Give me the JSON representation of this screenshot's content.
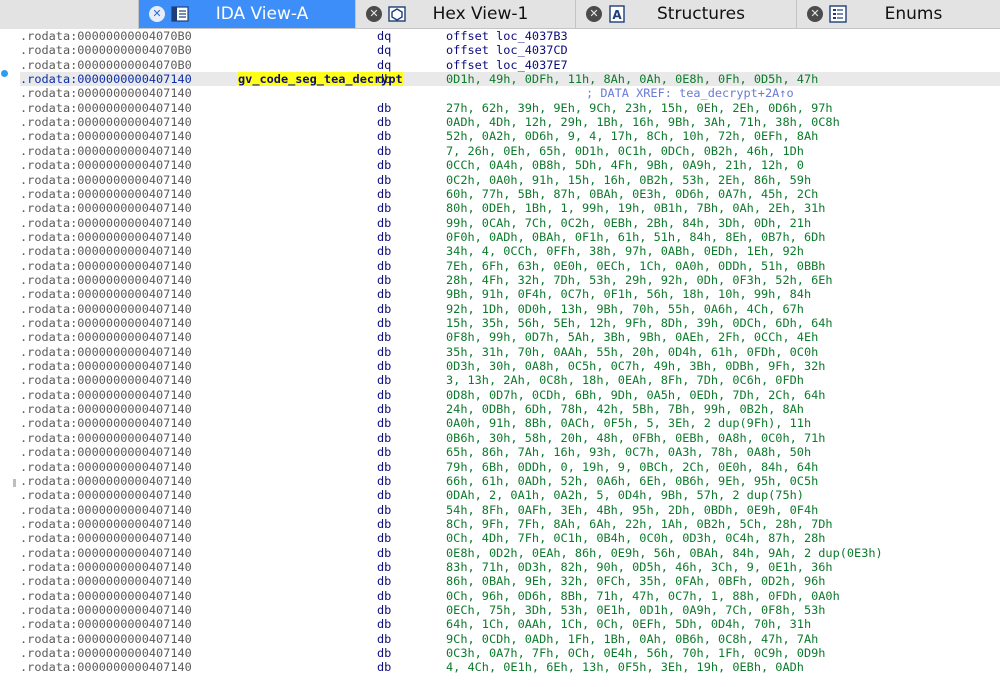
{
  "tabs": [
    {
      "label": "IDA View-A",
      "active": true,
      "icon": "ida-view-icon"
    },
    {
      "label": "Hex View-1",
      "active": false,
      "icon": "hex-view-icon"
    },
    {
      "label": "Structures",
      "active": false,
      "icon": "structures-icon"
    },
    {
      "label": "Enums",
      "active": false,
      "icon": "enums-icon"
    }
  ],
  "colors": {
    "accent": "#3d8ef8",
    "address": "#5b5b5b",
    "name_highlight": "#ffff1a",
    "operand": "#0c7a2c",
    "mnemonic": "#0b0b7c",
    "comment": "#6a7ad6"
  },
  "listing": [
    {
      "addr": ".rodata:00000000004070B0",
      "mnem": "dq",
      "ops": "offset loc_4037B3",
      "kind": "dq"
    },
    {
      "addr": ".rodata:00000000004070B0",
      "mnem": "dq",
      "ops": "offset loc_4037CD",
      "kind": "dq"
    },
    {
      "addr": ".rodata:00000000004070B0",
      "mnem": "dq",
      "ops": "offset loc_4037E7",
      "kind": "dq"
    },
    {
      "addr": ".rodata:0000000000407140",
      "name": "gv_code_seg_tea_decrypt",
      "mnem": "db",
      "ops": "0D1h, 49h, 0DFh, 11h, 8Ah, 0Ah, 0E8h, 0Fh, 0D5h, 47h",
      "kind": "db",
      "current": true
    },
    {
      "addr": ".rodata:0000000000407140",
      "comment": "; DATA XREF: tea_decrypt+2A↑o"
    },
    {
      "addr": ".rodata:0000000000407140",
      "mnem": "db",
      "ops": "27h, 62h, 39h, 9Eh, 9Ch, 23h, 15h, 0Eh, 2Eh, 0D6h, 97h"
    },
    {
      "addr": ".rodata:0000000000407140",
      "mnem": "db",
      "ops": "0ADh, 4Dh, 12h, 29h, 1Bh, 16h, 9Bh, 3Ah, 71h, 38h, 0C8h"
    },
    {
      "addr": ".rodata:0000000000407140",
      "mnem": "db",
      "ops": "52h, 0A2h, 0D6h, 9, 4, 17h, 8Ch, 10h, 72h, 0EFh, 8Ah"
    },
    {
      "addr": ".rodata:0000000000407140",
      "mnem": "db",
      "ops": "7, 26h, 0Eh, 65h, 0D1h, 0C1h, 0DCh, 0B2h, 46h, 1Dh"
    },
    {
      "addr": ".rodata:0000000000407140",
      "mnem": "db",
      "ops": "0CCh, 0A4h, 0B8h, 5Dh, 4Fh, 9Bh, 0A9h, 21h, 12h, 0"
    },
    {
      "addr": ".rodata:0000000000407140",
      "mnem": "db",
      "ops": "0C2h, 0A0h, 91h, 15h, 16h, 0B2h, 53h, 2Eh, 86h, 59h"
    },
    {
      "addr": ".rodata:0000000000407140",
      "mnem": "db",
      "ops": "60h, 77h, 5Bh, 87h, 0BAh, 0E3h, 0D6h, 0A7h, 45h, 2Ch"
    },
    {
      "addr": ".rodata:0000000000407140",
      "mnem": "db",
      "ops": "80h, 0DEh, 1Bh, 1, 99h, 19h, 0B1h, 7Bh, 0Ah, 2Eh, 31h"
    },
    {
      "addr": ".rodata:0000000000407140",
      "mnem": "db",
      "ops": "99h, 0CAh, 7Ch, 0C2h, 0EBh, 2Bh, 84h, 3Dh, 0Dh, 21h"
    },
    {
      "addr": ".rodata:0000000000407140",
      "mnem": "db",
      "ops": "0F0h, 0ADh, 0BAh, 0F1h, 61h, 51h, 84h, 8Eh, 0B7h, 6Dh"
    },
    {
      "addr": ".rodata:0000000000407140",
      "mnem": "db",
      "ops": "34h, 4, 0CCh, 0FFh, 38h, 97h, 0ABh, 0EDh, 1Eh, 92h"
    },
    {
      "addr": ".rodata:0000000000407140",
      "mnem": "db",
      "ops": "7Eh, 6Fh, 63h, 0E0h, 0ECh, 1Ch, 0A0h, 0DDh, 51h, 0BBh"
    },
    {
      "addr": ".rodata:0000000000407140",
      "mnem": "db",
      "ops": "28h, 4Fh, 32h, 7Dh, 53h, 29h, 92h, 0Dh, 0F3h, 52h, 6Eh"
    },
    {
      "addr": ".rodata:0000000000407140",
      "mnem": "db",
      "ops": "9Bh, 91h, 0F4h, 0C7h, 0F1h, 56h, 18h, 10h, 99h, 84h"
    },
    {
      "addr": ".rodata:0000000000407140",
      "mnem": "db",
      "ops": "92h, 1Dh, 0D0h, 13h, 9Bh, 70h, 55h, 0A6h, 4Ch, 67h"
    },
    {
      "addr": ".rodata:0000000000407140",
      "mnem": "db",
      "ops": "15h, 35h, 56h, 5Eh, 12h, 9Fh, 8Dh, 39h, 0DCh, 6Dh, 64h"
    },
    {
      "addr": ".rodata:0000000000407140",
      "mnem": "db",
      "ops": "0F8h, 99h, 0D7h, 5Ah, 3Bh, 9Bh, 0AEh, 2Fh, 0CCh, 4Eh"
    },
    {
      "addr": ".rodata:0000000000407140",
      "mnem": "db",
      "ops": "35h, 31h, 70h, 0AAh, 55h, 20h, 0D4h, 61h, 0FDh, 0C0h"
    },
    {
      "addr": ".rodata:0000000000407140",
      "mnem": "db",
      "ops": "0D3h, 30h, 0A8h, 0C5h, 0C7h, 49h, 3Bh, 0DBh, 9Fh, 32h"
    },
    {
      "addr": ".rodata:0000000000407140",
      "mnem": "db",
      "ops": "3, 13h, 2Ah, 0C8h, 18h, 0EAh, 8Fh, 7Dh, 0C6h, 0FDh"
    },
    {
      "addr": ".rodata:0000000000407140",
      "mnem": "db",
      "ops": "0D8h, 0D7h, 0CDh, 6Bh, 9Dh, 0A5h, 0EDh, 7Dh, 2Ch, 64h"
    },
    {
      "addr": ".rodata:0000000000407140",
      "mnem": "db",
      "ops": "24h, 0DBh, 6Dh, 78h, 42h, 5Bh, 7Bh, 99h, 0B2h, 8Ah"
    },
    {
      "addr": ".rodata:0000000000407140",
      "mnem": "db",
      "ops": "0A0h, 91h, 8Bh, 0ACh, 0F5h, 5, 3Eh, 2 dup(9Fh), 11h"
    },
    {
      "addr": ".rodata:0000000000407140",
      "mnem": "db",
      "ops": "0B6h, 30h, 58h, 20h, 48h, 0FBh, 0EBh, 0A8h, 0C0h, 71h"
    },
    {
      "addr": ".rodata:0000000000407140",
      "mnem": "db",
      "ops": "65h, 86h, 7Ah, 16h, 93h, 0C7h, 0A3h, 78h, 0A8h, 50h"
    },
    {
      "addr": ".rodata:0000000000407140",
      "mnem": "db",
      "ops": "79h, 6Bh, 0DDh, 0, 19h, 9, 0BCh, 2Ch, 0E0h, 84h, 64h"
    },
    {
      "addr": ".rodata:0000000000407140",
      "mnem": "db",
      "ops": "66h, 61h, 0ADh, 52h, 0A6h, 6Eh, 0B6h, 9Eh, 95h, 0C5h"
    },
    {
      "addr": ".rodata:0000000000407140",
      "mnem": "db",
      "ops": "0DAh, 2, 0A1h, 0A2h, 5, 0D4h, 9Bh, 57h, 2 dup(75h)"
    },
    {
      "addr": ".rodata:0000000000407140",
      "mnem": "db",
      "ops": "54h, 8Fh, 0AFh, 3Eh, 4Bh, 95h, 2Dh, 0BDh, 0E9h, 0F4h"
    },
    {
      "addr": ".rodata:0000000000407140",
      "mnem": "db",
      "ops": "8Ch, 9Fh, 7Fh, 8Ah, 6Ah, 22h, 1Ah, 0B2h, 5Ch, 28h, 7Dh"
    },
    {
      "addr": ".rodata:0000000000407140",
      "mnem": "db",
      "ops": "0Ch, 4Dh, 7Fh, 0C1h, 0B4h, 0C0h, 0D3h, 0C4h, 87h, 28h"
    },
    {
      "addr": ".rodata:0000000000407140",
      "mnem": "db",
      "ops": "0E8h, 0D2h, 0EAh, 86h, 0E9h, 56h, 0BAh, 84h, 9Ah, 2 dup(0E3h)"
    },
    {
      "addr": ".rodata:0000000000407140",
      "mnem": "db",
      "ops": "83h, 71h, 0D3h, 82h, 90h, 0D5h, 46h, 3Ch, 9, 0E1h, 36h"
    },
    {
      "addr": ".rodata:0000000000407140",
      "mnem": "db",
      "ops": "86h, 0BAh, 9Eh, 32h, 0FCh, 35h, 0FAh, 0BFh, 0D2h, 96h"
    },
    {
      "addr": ".rodata:0000000000407140",
      "mnem": "db",
      "ops": "0Ch, 96h, 0D6h, 8Bh, 71h, 47h, 0C7h, 1, 88h, 0FDh, 0A0h"
    },
    {
      "addr": ".rodata:0000000000407140",
      "mnem": "db",
      "ops": "0ECh, 75h, 3Dh, 53h, 0E1h, 0D1h, 0A9h, 7Ch, 0F8h, 53h"
    },
    {
      "addr": ".rodata:0000000000407140",
      "mnem": "db",
      "ops": "64h, 1Ch, 0AAh, 1Ch, 0Ch, 0EFh, 5Dh, 0D4h, 70h, 31h"
    },
    {
      "addr": ".rodata:0000000000407140",
      "mnem": "db",
      "ops": "9Ch, 0CDh, 0ADh, 1Fh, 1Bh, 0Ah, 0B6h, 0C8h, 47h, 7Ah"
    },
    {
      "addr": ".rodata:0000000000407140",
      "mnem": "db",
      "ops": "0C3h, 0A7h, 7Fh, 0Ch, 0E4h, 56h, 70h, 1Fh, 0C9h, 0D9h"
    },
    {
      "addr": ".rodata:0000000000407140",
      "mnem": "db",
      "ops": "4, 4Ch, 0E1h, 6Eh, 13h, 0F5h, 3Eh, 19h, 0EBh, 0ADh"
    }
  ]
}
